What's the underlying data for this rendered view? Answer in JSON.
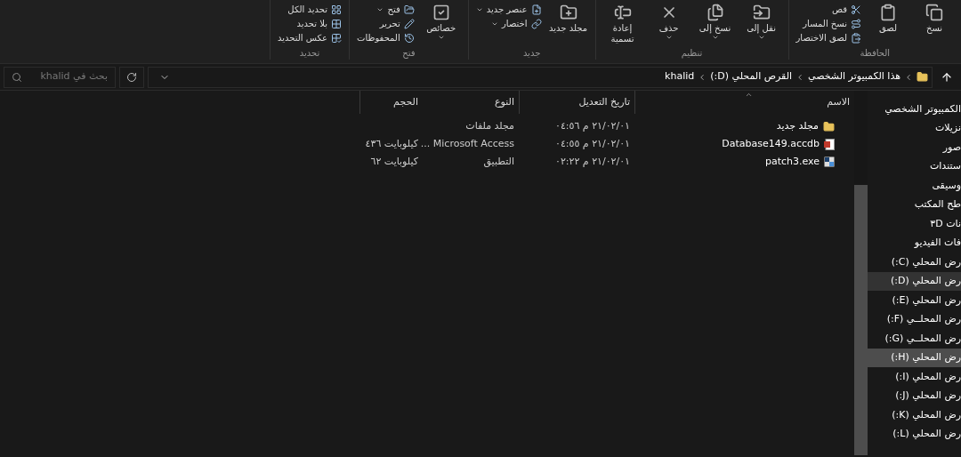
{
  "ribbon": {
    "groups": [
      {
        "label": "الحافظة",
        "items": [
          {
            "kind": "large",
            "label": "نسخ",
            "dropdown": false
          },
          {
            "kind": "large",
            "label": "لصق",
            "dropdown": false
          },
          {
            "kind": "small",
            "label": "قص"
          },
          {
            "kind": "small",
            "label": "نسخ المسار"
          },
          {
            "kind": "small",
            "label": "لصق الاختصار"
          }
        ]
      },
      {
        "label": "تنظيم",
        "items": [
          {
            "kind": "large",
            "label": "نقل إلى",
            "dropdown": true
          },
          {
            "kind": "large",
            "label": "نسخ إلى",
            "dropdown": true
          },
          {
            "kind": "large",
            "label": "حذف",
            "dropdown": true
          },
          {
            "kind": "large",
            "label": "إعادة تسمية",
            "dropdown": false
          }
        ]
      },
      {
        "label": "جديد",
        "items": [
          {
            "kind": "large",
            "label": "مجلد جديد",
            "dropdown": false
          },
          {
            "kind": "small",
            "label": "عنصر جديد",
            "dropdown": true
          },
          {
            "kind": "small",
            "label": "اختصار",
            "dropdown": true
          }
        ]
      },
      {
        "label": "فتح",
        "items": [
          {
            "kind": "large",
            "label": "خصائص",
            "dropdown": true
          },
          {
            "kind": "small",
            "label": "فتح",
            "dropdown": true
          },
          {
            "kind": "small",
            "label": "تحرير"
          },
          {
            "kind": "small",
            "label": "المحفوظات"
          }
        ]
      },
      {
        "label": "تحديد",
        "items": [
          {
            "kind": "small",
            "label": "تحديد الكل"
          },
          {
            "kind": "small",
            "label": "بلا تحديد"
          },
          {
            "kind": "small",
            "label": "عكس التحديد"
          }
        ]
      }
    ]
  },
  "address": {
    "path": [
      "هذا الكمبيوتر الشخصي",
      "القرص المحلي (D:)",
      "khalid"
    ]
  },
  "search": {
    "placeholder": "بحث في khalid"
  },
  "columns": [
    {
      "label": "الاسم",
      "sorted": true
    },
    {
      "label": "تاريخ التعديل",
      "sorted": false
    },
    {
      "label": "النوع",
      "sorted": false
    },
    {
      "label": "الحجم",
      "sorted": false
    }
  ],
  "files": [
    {
      "kind": "folder",
      "name": "مجلد جديد",
      "modified": "٢١/٠٢/٠١ م ٠٤:٥٦",
      "type": "مجلد ملفات"
    },
    {
      "kind": "access",
      "name": "Database149.accdb",
      "modified": "٢١/٠٢/٠١ م ٠٤:٥٥",
      "type": "Microsoft Access ...",
      "size": "كيلوبايت ٤٣٦"
    },
    {
      "kind": "exe",
      "name": "patch3.exe",
      "modified": "٢١/٠٢/٠١ م ٠٢:٢٢",
      "type": "التطبيق",
      "size": "كيلوبايت ٦٢"
    }
  ],
  "nav": [
    {
      "label": "الكمبيوتر الشخصي",
      "selected": false,
      "hovered": false
    },
    {
      "label": "نزيلات",
      "selected": false,
      "hovered": false
    },
    {
      "label": "صور",
      "selected": false,
      "hovered": false
    },
    {
      "label": "ستندات",
      "selected": false,
      "hovered": false
    },
    {
      "label": "وسيقى",
      "selected": false,
      "hovered": false
    },
    {
      "label": "طح المكتب",
      "selected": false,
      "hovered": false
    },
    {
      "label": "نات ٣D",
      "selected": false,
      "hovered": false
    },
    {
      "label": "فات الفيديو",
      "selected": false,
      "hovered": false
    },
    {
      "label": "رض المحلي (C:)",
      "selected": false,
      "hovered": false
    },
    {
      "label": "رض المحلي (D:)",
      "selected": true,
      "hovered": false
    },
    {
      "label": "رض المحلي (E:)",
      "selected": false,
      "hovered": false
    },
    {
      "label": "رض المحلــي (F:)",
      "selected": false,
      "hovered": false
    },
    {
      "label": "رض المحلــي (G:)",
      "selected": false,
      "hovered": false
    },
    {
      "label": "رض المحلي (H:)",
      "selected": false,
      "hovered": true
    },
    {
      "label": "رض المحلي (I:)",
      "selected": false,
      "hovered": false
    },
    {
      "label": "رض المحلي (J:)",
      "selected": false,
      "hovered": false
    },
    {
      "label": "رض المحلي (K:)",
      "selected": false,
      "hovered": false
    },
    {
      "label": "رض المحلي (L:)",
      "selected": false,
      "hovered": false
    }
  ]
}
